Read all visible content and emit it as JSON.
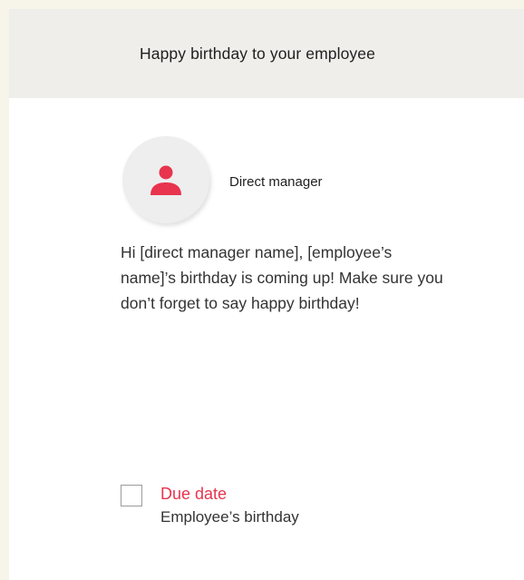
{
  "card": {
    "title": "Happy birthday to your employee"
  },
  "sender": {
    "icon": "person-icon",
    "role": "Direct manager"
  },
  "message": {
    "text": "Hi [direct manager name], [employee’s name]’s birthday is coming up! Make sure you don’t forget to say happy birthday!"
  },
  "task": {
    "checked": false,
    "due_label": "Due date",
    "due_value": "Employee’s birthday"
  },
  "colors": {
    "accent": "#e8344e",
    "page_background": "#f7f5ea",
    "header_background": "#efeeeb",
    "avatar_background": "#eeeeee"
  }
}
